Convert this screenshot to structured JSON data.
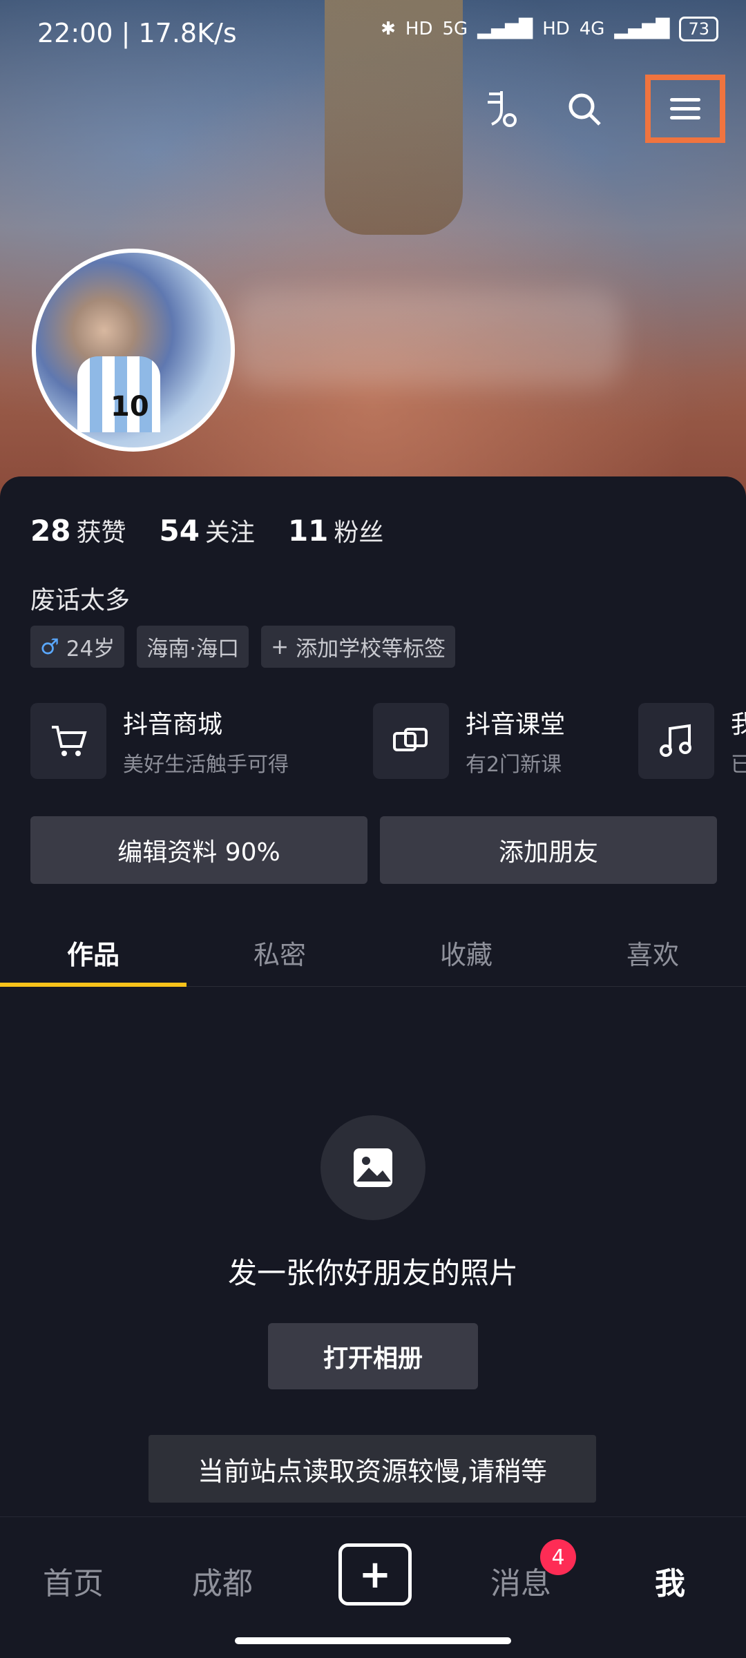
{
  "status_bar": {
    "time": "22:00",
    "speed": "17.8K/s",
    "signal_labels": [
      "HD",
      "5G",
      "HD",
      "4G"
    ],
    "battery": "73"
  },
  "profile": {
    "stats": [
      {
        "num": "28",
        "label": "获赞"
      },
      {
        "num": "54",
        "label": "关注"
      },
      {
        "num": "11",
        "label": "粉丝"
      }
    ],
    "bio": "废话太多",
    "tags": {
      "gender_icon": "male-icon",
      "age": "24岁",
      "location": "海南·海口",
      "add_school": "添加学校等标签"
    }
  },
  "services": [
    {
      "icon": "cart-icon",
      "title": "抖音商城",
      "subtitle": "美好生活触手可得"
    },
    {
      "icon": "classroom-icon",
      "title": "抖音课堂",
      "subtitle": "有2门新课"
    },
    {
      "icon": "music-icon",
      "title": "我",
      "subtitle": "已"
    }
  ],
  "buttons": {
    "edit_profile": "编辑资料 90%",
    "add_friend": "添加朋友"
  },
  "tabs": [
    "作品",
    "私密",
    "收藏",
    "喜欢"
  ],
  "empty_state": {
    "message": "发一张你好朋友的照片",
    "button": "打开相册"
  },
  "toast": "当前站点读取资源较慢,请稍等",
  "bottom_nav": {
    "home": "首页",
    "city": "成都",
    "messages": "消息",
    "messages_badge": "4",
    "me": "我"
  },
  "colors": {
    "accent": "#f7c21a",
    "badge": "#fe2c55",
    "highlight_box": "#f0743f",
    "background": "#161823"
  }
}
